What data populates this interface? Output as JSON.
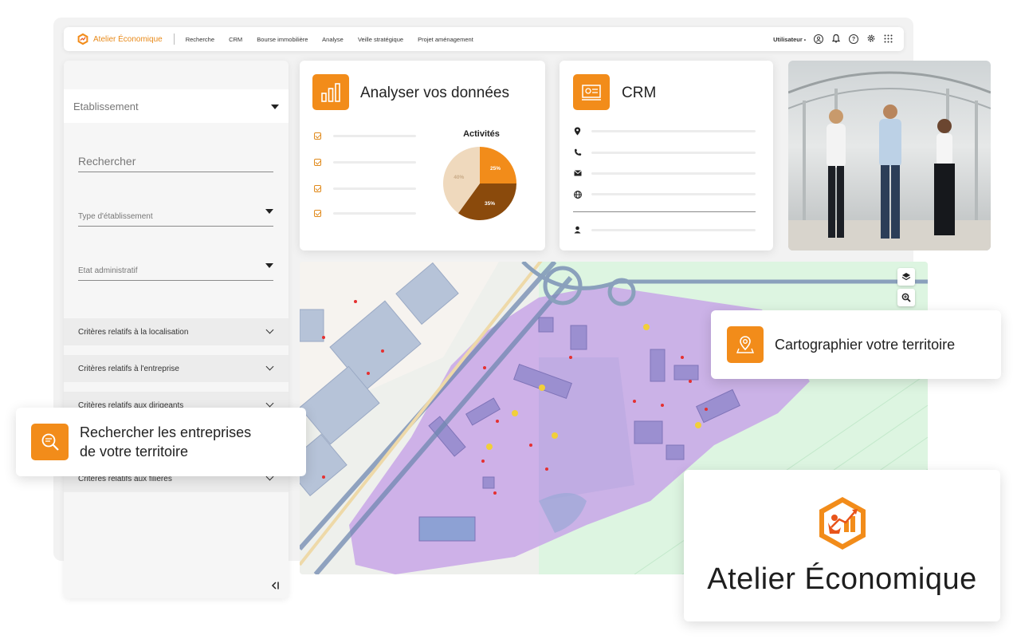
{
  "app": {
    "brand": "Atelier Économique"
  },
  "nav": {
    "items": [
      "Recherche",
      "CRM",
      "Bourse immobilière",
      "Analyse",
      "Veille stratégique",
      "Projet aménagement"
    ]
  },
  "user": {
    "label": "Utilisateur"
  },
  "sidebar": {
    "select_label": "Etablissement",
    "search_placeholder": "Rechercher",
    "type_label": "Type d'établissement",
    "etat_label": "Etat administratif",
    "criteria": [
      "Critères relatifs à la localisation",
      "Critères relatifs à l'entreprise",
      "Critères relatifs aux dirigeants",
      "Critères relatifs aux filières"
    ],
    "collapse_icon": "collapse-left-icon"
  },
  "analyse": {
    "title": "Analyser vos données",
    "icon": "bar-chart-icon"
  },
  "chart_data": {
    "type": "pie",
    "title": "Activités",
    "labels": [
      "",
      "",
      ""
    ],
    "values": [
      25,
      35,
      40
    ],
    "value_labels": [
      "25%",
      "35%",
      "40%"
    ],
    "colors": [
      "#f28c1a",
      "#8a4a0c",
      "#efd9bd"
    ]
  },
  "crm": {
    "title": "CRM",
    "icon": "crm-dashboard-icon",
    "rows": [
      "location-icon",
      "phone-icon",
      "mail-icon",
      "globe-icon",
      "user-icon"
    ]
  },
  "callouts": {
    "carto": "Cartographier votre territoire",
    "recherche_line1": "Rechercher les entreprises",
    "recherche_line2": "de votre territoire"
  },
  "logo_card": {
    "title": "Atelier Économique"
  },
  "colors": {
    "accent": "#f28c1a",
    "zone": "#c8a6e8"
  }
}
